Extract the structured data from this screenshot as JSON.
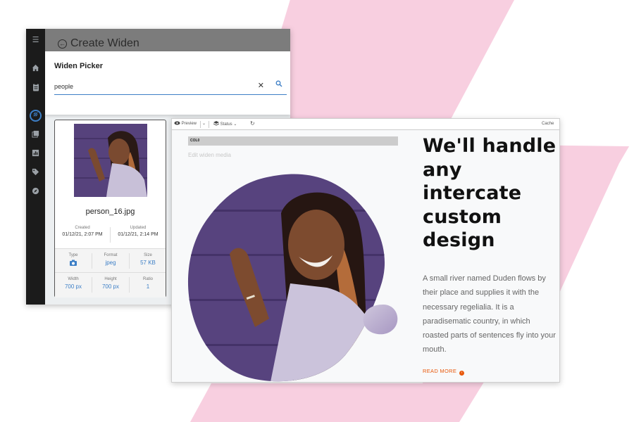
{
  "app": {
    "header_title": "Create Widen",
    "rail_icons": [
      "menu-icon",
      "home-icon",
      "clipboard-icon",
      "widen-icon",
      "gallery-icon",
      "chart-icon",
      "tag-icon",
      "compass-icon"
    ]
  },
  "picker": {
    "title": "Widen Picker",
    "search_value": "people",
    "clear_glyph": "✕"
  },
  "asset": {
    "filename": "person_16.jpg",
    "created_label": "Created",
    "created_value": "01/12/21, 2:07 PM",
    "updated_label": "Updated",
    "updated_value": "01/12/21, 2:14 PM",
    "type_label": "Type",
    "format_label": "Format",
    "format_value": "jpeg",
    "size_label": "Size",
    "size_value": "57 KB",
    "width_label": "Width",
    "width_value": "700 px",
    "height_label": "Height",
    "height_value": "700 px",
    "ratio_label": "Ratio",
    "ratio_value": "1"
  },
  "editor": {
    "toolbar": {
      "preview_label": "Preview",
      "status_label": "Status",
      "cache_label": "Cache"
    },
    "code_label": "COL0",
    "edit_hint": "Edit widen media",
    "headline": "We'll handle any intercate custom design",
    "paragraph": "A small river named Duden flows by their place and supplies it with the necessary regelialia. It is a paradisematic country, in which roasted parts of sentences fly into your mouth.",
    "read_more": "READ MORE"
  },
  "colors": {
    "pink_bg": "#f8cfe0",
    "accent_blue": "#3d7fc6",
    "read_more_orange": "#e8590c",
    "rail_dark": "#1b1b1b"
  }
}
